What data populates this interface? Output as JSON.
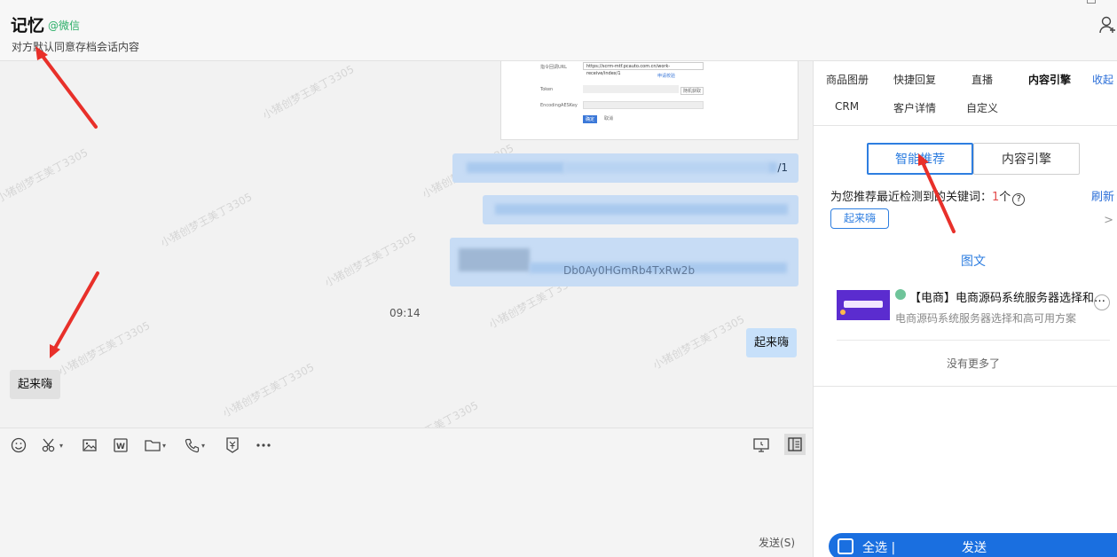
{
  "header": {
    "contact_name": "记忆",
    "contact_tag": "@微信",
    "subtitle": "对方默认同意存档会话内容"
  },
  "chat": {
    "watermark": "小猪创梦王美丁3305",
    "screenshot_fields": {
      "url_label": "指令回调URL",
      "url_value": "https://scrm-mtf.pcauto.com.cn/work-receive/index/1",
      "token_label": "Token",
      "aes_label": "EncodingAESKey",
      "generate_link": "申请校验",
      "random_get": "随机获取",
      "confirm": "确定",
      "cancel": "取消"
    },
    "blurred_1_tail": "/1",
    "blurred_3_text": "Db0Ay0HGmRb4TxRw2b",
    "time": "09:14",
    "outgoing_message": "起来嗨",
    "incoming_message": "起来嗨"
  },
  "toolbar": {
    "send_label": "发送(S)"
  },
  "panel": {
    "tabs": [
      "商品图册",
      "快捷回复",
      "直播",
      "内容引擎",
      "收起",
      "CRM",
      "客户详情",
      "自定义"
    ],
    "active_tab": "内容引擎",
    "segment_on": "智能推荐",
    "segment_off": "内容引擎",
    "keyword_prefix": "为您推荐最近检测到的关键词：",
    "keyword_count": "1",
    "keyword_suffix": "个",
    "refresh": "刷新",
    "keyword_chip": "起来嗨",
    "section_title": "图文",
    "article_title": "【电商】电商源码系统服务器选择和高可用方案",
    "article_desc": "电商源码系统服务器选择和高可用方案",
    "no_more": "没有更多了",
    "select_all": "全选 |",
    "send": "发送"
  },
  "colors": {
    "accent_blue": "#2e7ee0",
    "bubble_blue": "#c7e0fa",
    "arrow_red": "#e8302a",
    "send_bar": "#1a6fe0"
  },
  "icons": [
    "emoji-icon",
    "scissors-icon",
    "image-icon",
    "word-doc-icon",
    "folder-icon",
    "phone-icon",
    "red-packet-icon",
    "more-icon",
    "screen-share-icon",
    "side-panel-icon",
    "add-member-icon",
    "help-icon",
    "chevron-right-icon"
  ]
}
